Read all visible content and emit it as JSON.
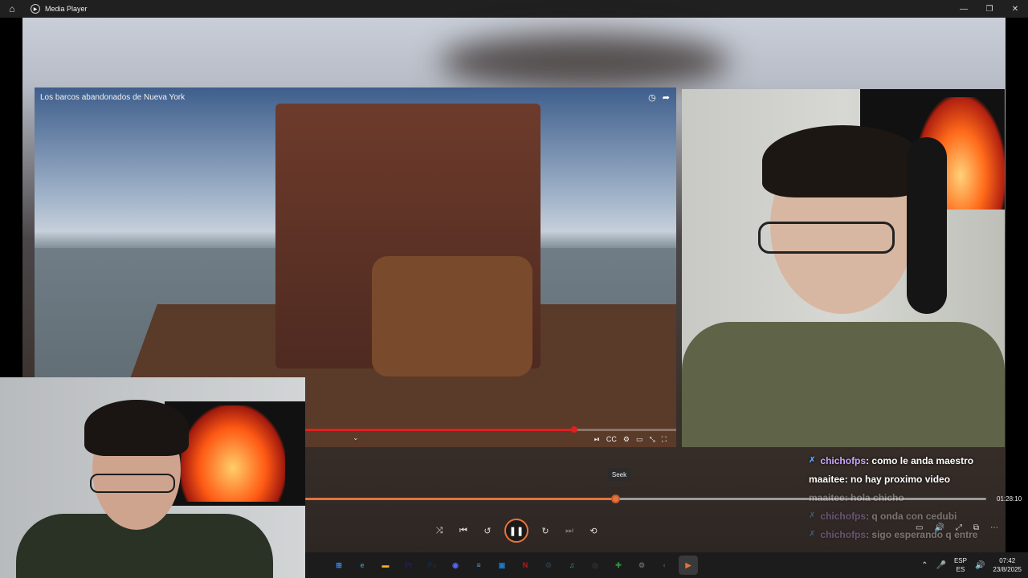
{
  "window": {
    "title": "Media Player",
    "home_icon": "home-icon",
    "app_icon": "play-circle-icon"
  },
  "winctl": {
    "minimize": "—",
    "restore": "❐",
    "close": "✕"
  },
  "video": {
    "title": "Los barcos abandonados de Nueva York",
    "icons": {
      "clock": "◷",
      "share": "➦"
    },
    "progress": 0.84,
    "chevron": "⌄",
    "ctrls": [
      "⏯",
      "CC",
      "⚙",
      "▭",
      "⤡",
      "⛶"
    ]
  },
  "seek_tooltip": "Seek",
  "player": {
    "progress": 0.455,
    "duration": "01:28:10",
    "buttons": {
      "shuffle": "⤨",
      "prev": "⏮",
      "back": "↺",
      "play": "❚❚",
      "forward": "↻",
      "next": "⏭",
      "repeat": "⟲"
    },
    "right": [
      "▭",
      "🔊",
      "⤢",
      "⧉",
      "⋯"
    ]
  },
  "chat": [
    {
      "user": "chichofps",
      "text": ": como le anda maestro",
      "badge": true,
      "dim": false
    },
    {
      "user": "maaitee",
      "text": ": no hay proximo video",
      "badge": false,
      "dim": false
    },
    {
      "user": "maaitee",
      "text": ": hola chicho",
      "badge": false,
      "dim": true
    },
    {
      "user": "chichofps",
      "text": ": q onda con cedubi",
      "badge": true,
      "dim": true
    },
    {
      "user": "chichofps",
      "text": ": sigo esperando q entre",
      "badge": true,
      "dim": true
    }
  ],
  "taskbar": {
    "apps": [
      {
        "name": "windows",
        "label": "⊞",
        "color": "#3b8bf0"
      },
      {
        "name": "edge",
        "label": "e",
        "color": "#1f8fd6"
      },
      {
        "name": "explorer",
        "label": "▬",
        "color": "#f2b51e"
      },
      {
        "name": "premiere",
        "label": "Pr",
        "color": "#2d1a5a"
      },
      {
        "name": "photoshop",
        "label": "Ps",
        "color": "#0f2a4a"
      },
      {
        "name": "discord",
        "label": "◉",
        "color": "#5865f2"
      },
      {
        "name": "notepad",
        "label": "≡",
        "color": "#4aa0e6"
      },
      {
        "name": "vscode",
        "label": "▣",
        "color": "#1c7bcc"
      },
      {
        "name": "netflix",
        "label": "N",
        "color": "#c4161c"
      },
      {
        "name": "steam",
        "label": "⚙",
        "color": "#2a3a4a"
      },
      {
        "name": "spotify",
        "label": "♫",
        "color": "#1db954"
      },
      {
        "name": "obs",
        "label": "◎",
        "color": "#333"
      },
      {
        "name": "gamepass",
        "label": "✚",
        "color": "#2f8f3f"
      },
      {
        "name": "settings",
        "label": "⚙",
        "color": "#666"
      },
      {
        "name": "obs2",
        "label": "◐",
        "color": "#444"
      },
      {
        "name": "media-player",
        "label": "▶",
        "color": "#e8733a"
      }
    ],
    "tray": {
      "chevron": "⌃",
      "mic": "🎤",
      "lang1": "ESP",
      "lang2": "ES",
      "speaker": "🔊",
      "time": "07:42",
      "date": "23/8/2025"
    }
  }
}
